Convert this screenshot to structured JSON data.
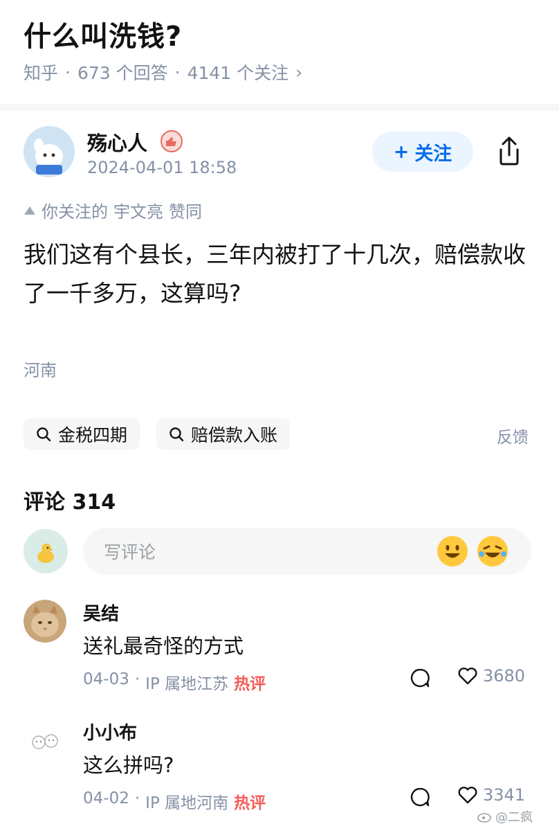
{
  "question": {
    "title": "什么叫洗钱?",
    "source": "知乎",
    "answers": "673 个回答",
    "follows": "4141 个关注",
    "chevron": "›"
  },
  "author": {
    "name": "殇心人",
    "time": "2024-04-01 18:58",
    "follow_label": "关注",
    "follow_plus": "+"
  },
  "upvote_line": {
    "prefix": "你关注的",
    "user": "宇文亮",
    "suffix": "赞同"
  },
  "answer": {
    "text": "我们这有个县长，三年内被打了十几次，赔偿款收了一千多万，这算吗?",
    "location": "河南"
  },
  "tags": [
    {
      "label": "金税四期",
      "icon": "search-icon"
    },
    {
      "label": "赔偿款入账",
      "icon": "search-icon"
    }
  ],
  "feedback_label": "反馈",
  "comments": {
    "title": "评论 314",
    "input_placeholder": "写评论",
    "items": [
      {
        "name": "吴结",
        "text": "送礼最奇怪的方式",
        "date": "04-03",
        "ip": "IP 属地江苏",
        "hot": "热评",
        "likes": "3680"
      },
      {
        "name": "小小布",
        "text": "这么拼吗?",
        "date": "04-02",
        "ip": "IP 属地河南",
        "hot": "热评",
        "likes": "3341"
      }
    ]
  },
  "watermark": "@二疯",
  "colors": {
    "accent": "#056de8",
    "muted": "#8590a6",
    "hot": "#f1403c"
  }
}
